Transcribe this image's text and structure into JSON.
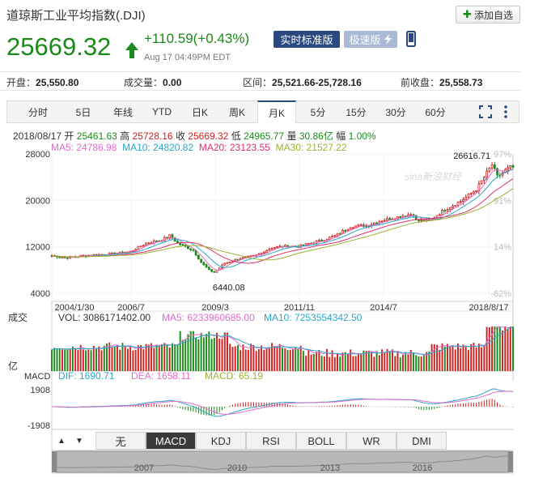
{
  "header": {
    "title": "道琼斯工业平均指数(.DJI)",
    "add_label": "添加自选",
    "price": "25669.32",
    "change": "+110.59(+0.43%)",
    "time": "Aug 17 04:49PM EDT",
    "realtime_label": "实时标准版",
    "fast_label": "极速版"
  },
  "stats": {
    "open_label": "开盘：",
    "open": "25,550.80",
    "volume_label": "成交量：",
    "volume": "0.00",
    "range_label": "区间：",
    "range": "25,521.66-25,728.16",
    "prev_label": "前收盘：",
    "prev": "25,558.73"
  },
  "tabs": [
    "分时",
    "5日",
    "年线",
    "YTD",
    "日K",
    "周K",
    "月K",
    "5分",
    "15分",
    "30分",
    "60分"
  ],
  "active_tab": "月K",
  "info": {
    "date": "2018/08/17",
    "open_label": "开",
    "open": "25461.63",
    "high_label": "高",
    "high": "25728.16",
    "close_label": "收",
    "close": "25669.32",
    "low_label": "低",
    "low": "24965.77",
    "vol_label": "量",
    "vol": "30.86亿",
    "amp_label": "幅",
    "amp": "1.00%",
    "ma5": "MA5: 24786.98",
    "ma10": "MA10: 24820.82",
    "ma20": "MA20: 23123.55",
    "ma30": "MA30: 21527.22"
  },
  "watermark": "sina新浪财经",
  "volume_panel": {
    "label": "成交",
    "unit": "亿",
    "vol": "VOL: 3086171402.00",
    "ma5": "MA5: 6233960685.00",
    "ma10": "MA10: 7253554342.50"
  },
  "macd_panel": {
    "label": "MACD",
    "dif": "DIF: 1690.71",
    "dea": "DEA: 1658.11",
    "macd": "MACD: 65.19",
    "ticks": [
      "1908",
      "-1908"
    ]
  },
  "indicator_tabs": [
    "无",
    "MACD",
    "KDJ",
    "RSI",
    "BOLL",
    "WR",
    "DMI"
  ],
  "active_indicator": "MACD",
  "navigator_years": [
    "2007",
    "2010",
    "2013",
    "2016"
  ],
  "colors": {
    "up": "#d02020",
    "down": "#1a8a1a",
    "accent": "#2a4a7f"
  },
  "chart_data": {
    "type": "candlestick",
    "interval": "monthly",
    "x_ticks": [
      "2004/1/30",
      "2006/7",
      "2009/3",
      "2011/11",
      "2014/7",
      "2018/8/17"
    ],
    "y_ticks": [
      28000,
      20000,
      12000,
      4000
    ],
    "y_ticks_right": [
      "97%",
      "91%",
      "14%",
      "-62%"
    ],
    "ylim": [
      4000,
      28000
    ],
    "annotations": [
      {
        "label": "26616.71",
        "x": "2018/1",
        "y": 26616.71
      },
      {
        "label": "6440.08",
        "x": "2009/3",
        "y": 6440.08
      }
    ],
    "close_series": [
      [
        "2004/1",
        10490
      ],
      [
        "2004/7",
        10140
      ],
      [
        "2005/1",
        10490
      ],
      [
        "2005/7",
        10640
      ],
      [
        "2006/1",
        10860
      ],
      [
        "2006/7",
        11180
      ],
      [
        "2007/1",
        12620
      ],
      [
        "2007/7",
        13210
      ],
      [
        "2007/10",
        13930
      ],
      [
        "2008/1",
        12650
      ],
      [
        "2008/7",
        11380
      ],
      [
        "2008/10",
        9330
      ],
      [
        "2009/1",
        8000
      ],
      [
        "2009/3",
        7610
      ],
      [
        "2009/7",
        9170
      ],
      [
        "2010/1",
        10070
      ],
      [
        "2010/7",
        10470
      ],
      [
        "2011/1",
        11890
      ],
      [
        "2011/7",
        12140
      ],
      [
        "2011/11",
        12050
      ],
      [
        "2012/7",
        13010
      ],
      [
        "2013/1",
        13860
      ],
      [
        "2013/7",
        15500
      ],
      [
        "2014/1",
        15700
      ],
      [
        "2014/7",
        16560
      ],
      [
        "2015/1",
        17160
      ],
      [
        "2015/7",
        17690
      ],
      [
        "2015/8",
        16530
      ],
      [
        "2016/1",
        16470
      ],
      [
        "2016/7",
        18430
      ],
      [
        "2017/1",
        19860
      ],
      [
        "2017/7",
        21890
      ],
      [
        "2018/1",
        26150
      ],
      [
        "2018/3",
        24100
      ],
      [
        "2018/7",
        25410
      ],
      [
        "2018/8",
        25669.32
      ]
    ]
  }
}
